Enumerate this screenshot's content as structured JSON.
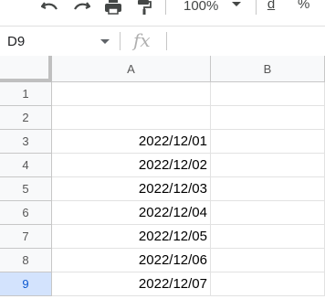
{
  "toolbar": {
    "undo_icon": "undo-icon",
    "redo_icon": "redo-icon",
    "print_icon": "print-icon",
    "paint_format_icon": "paint-format-icon",
    "zoom": "100%",
    "currency_label": "d",
    "percent_label": "%"
  },
  "formula_bar": {
    "name_box": "D9",
    "fx_label": "fx",
    "formula": ""
  },
  "grid": {
    "columns": [
      "A",
      "B"
    ],
    "rows": [
      {
        "num": "1",
        "a": "",
        "b": ""
      },
      {
        "num": "2",
        "a": "",
        "b": ""
      },
      {
        "num": "3",
        "a": "2022/12/01",
        "b": ""
      },
      {
        "num": "4",
        "a": "2022/12/02",
        "b": ""
      },
      {
        "num": "5",
        "a": "2022/12/03",
        "b": ""
      },
      {
        "num": "6",
        "a": "2022/12/04",
        "b": ""
      },
      {
        "num": "7",
        "a": "2022/12/05",
        "b": ""
      },
      {
        "num": "8",
        "a": "2022/12/06",
        "b": ""
      },
      {
        "num": "9",
        "a": "2022/12/07",
        "b": ""
      }
    ],
    "selected_row": "9"
  },
  "colors": {
    "header_bg": "#f8f9fa",
    "selected_header_bg": "#d3e3fd",
    "grid_line": "#e2e2e2",
    "icon": "#444746"
  }
}
